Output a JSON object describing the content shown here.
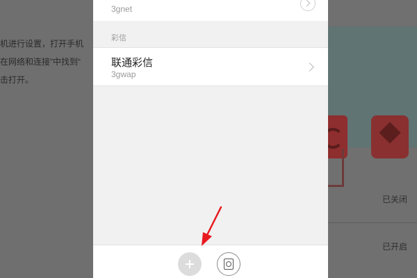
{
  "background_article": {
    "lines": [
      "机进行设置，打开手机",
      "在网络和连接”中找到“",
      "击打开。"
    ],
    "status_off": "已关闭",
    "status_on": "已开启"
  },
  "apn_list": {
    "top_item": {
      "title": "",
      "subtitle": "3gnet"
    },
    "mms_section_label": "彩信",
    "mms_item": {
      "title": "联通彩信",
      "subtitle": "3gwap"
    }
  },
  "bottom_bar": {
    "add_icon": "plus-icon",
    "scan_icon": "scan-icon"
  },
  "annotation": {
    "color": "#e8191f"
  }
}
